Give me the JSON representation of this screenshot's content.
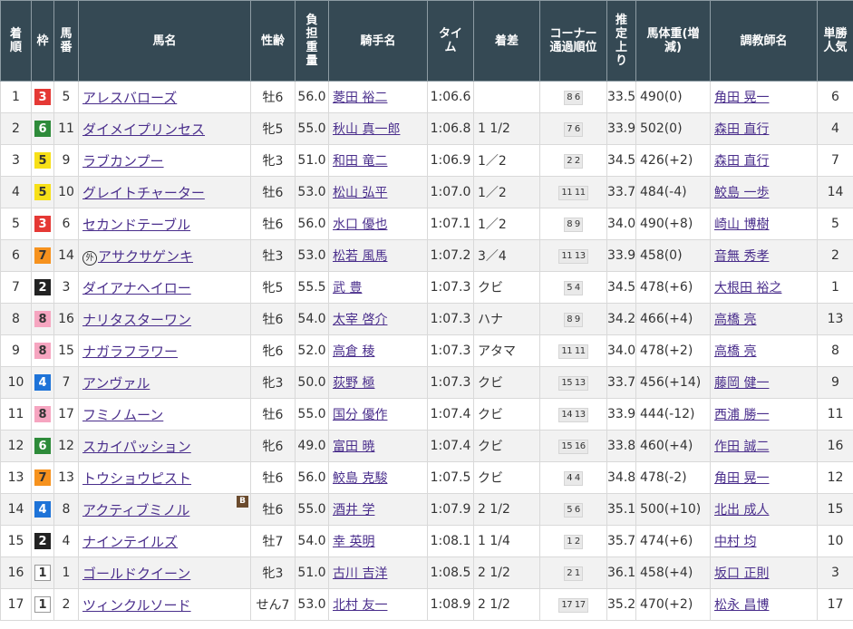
{
  "headers": {
    "rank": "着順",
    "waku": "枠",
    "num": "馬番",
    "name": "馬名",
    "sexage": "性齢",
    "weight": "負担重量",
    "jockey": "騎手名",
    "time": "タイム",
    "margin": "着差",
    "corner": "コーナー通過順位",
    "last3f": "推定上り",
    "body": "馬体重(増減)",
    "trainer": "調教師名",
    "pop": "単勝人気"
  },
  "waku_colors": {
    "1": {
      "bg": "#ffffff",
      "fg": "#333333",
      "border": "#999999"
    },
    "2": {
      "bg": "#222222",
      "fg": "#ffffff",
      "border": "#222222"
    },
    "3": {
      "bg": "#e53935",
      "fg": "#ffffff",
      "border": "#e53935"
    },
    "4": {
      "bg": "#1e73d8",
      "fg": "#ffffff",
      "border": "#1e73d8"
    },
    "5": {
      "bg": "#f7e018",
      "fg": "#333333",
      "border": "#f7e018"
    },
    "6": {
      "bg": "#2e8b3a",
      "fg": "#ffffff",
      "border": "#2e8b3a"
    },
    "7": {
      "bg": "#f6921e",
      "fg": "#333333",
      "border": "#f6921e"
    },
    "8": {
      "bg": "#f6a5c0",
      "fg": "#333333",
      "border": "#f6a5c0"
    }
  },
  "rows": [
    {
      "rank": "1",
      "waku": "3",
      "num": "5",
      "name": "アレスバローズ",
      "sexage": "牡6",
      "weight": "56.0",
      "jockey": "菱田 裕二",
      "time": "1:06.6",
      "margin": "",
      "corner": "8 6",
      "last3f": "33.5",
      "body": "490(0)",
      "trainer": "角田 晃一",
      "pop": "6"
    },
    {
      "rank": "2",
      "waku": "6",
      "num": "11",
      "name": "ダイメイプリンセス",
      "sexage": "牝5",
      "weight": "55.0",
      "jockey": "秋山 真一郎",
      "time": "1:06.8",
      "margin": "1 1/2",
      "corner": "7 6",
      "last3f": "33.9",
      "body": "502(0)",
      "trainer": "森田 直行",
      "pop": "4"
    },
    {
      "rank": "3",
      "waku": "5",
      "num": "9",
      "name": "ラブカンプー",
      "sexage": "牝3",
      "weight": "51.0",
      "jockey": "和田 竜二",
      "time": "1:06.9",
      "margin": "1／2",
      "corner": "2 2",
      "last3f": "34.5",
      "body": "426(+2)",
      "trainer": "森田 直行",
      "pop": "7"
    },
    {
      "rank": "4",
      "waku": "5",
      "num": "10",
      "name": "グレイトチャーター",
      "sexage": "牡6",
      "weight": "53.0",
      "jockey": "松山 弘平",
      "time": "1:07.0",
      "margin": "1／2",
      "corner": "11 11",
      "last3f": "33.7",
      "body": "484(-4)",
      "trainer": "鮫島 一歩",
      "pop": "14"
    },
    {
      "rank": "5",
      "waku": "3",
      "num": "6",
      "name": "セカンドテーブル",
      "sexage": "牡6",
      "weight": "56.0",
      "jockey": "水口 優也",
      "time": "1:07.1",
      "margin": "1／2",
      "corner": "8 9",
      "last3f": "34.0",
      "body": "490(+8)",
      "trainer": "崎山 博樹",
      "pop": "5"
    },
    {
      "rank": "6",
      "waku": "7",
      "num": "14",
      "name": "アサクサゲンキ",
      "maru": "外",
      "sexage": "牡3",
      "weight": "53.0",
      "jockey": "松若 風馬",
      "time": "1:07.2",
      "margin": "3／4",
      "corner": "11 13",
      "last3f": "33.9",
      "body": "458(0)",
      "trainer": "音無 秀孝",
      "pop": "2"
    },
    {
      "rank": "7",
      "waku": "2",
      "num": "3",
      "name": "ダイアナヘイロー",
      "sexage": "牝5",
      "weight": "55.5",
      "jockey": "武 豊",
      "time": "1:07.3",
      "margin": "クビ",
      "corner": "5 4",
      "last3f": "34.5",
      "body": "478(+6)",
      "trainer": "大根田 裕之",
      "pop": "1"
    },
    {
      "rank": "8",
      "waku": "8",
      "num": "16",
      "name": "ナリタスターワン",
      "sexage": "牡6",
      "weight": "54.0",
      "jockey": "太宰 啓介",
      "time": "1:07.3",
      "margin": "ハナ",
      "corner": "8 9",
      "last3f": "34.2",
      "body": "466(+4)",
      "trainer": "高橋 亮",
      "pop": "13"
    },
    {
      "rank": "9",
      "waku": "8",
      "num": "15",
      "name": "ナガラフラワー",
      "sexage": "牝6",
      "weight": "52.0",
      "jockey": "高倉 稜",
      "time": "1:07.3",
      "margin": "アタマ",
      "corner": "11 11",
      "last3f": "34.0",
      "body": "478(+2)",
      "trainer": "高橋 亮",
      "pop": "8"
    },
    {
      "rank": "10",
      "waku": "4",
      "num": "7",
      "name": "アンヴァル",
      "sexage": "牝3",
      "weight": "50.0",
      "jockey": "荻野 極",
      "time": "1:07.3",
      "margin": "クビ",
      "corner": "15 13",
      "last3f": "33.7",
      "body": "456(+14)",
      "trainer": "藤岡 健一",
      "pop": "9"
    },
    {
      "rank": "11",
      "waku": "8",
      "num": "17",
      "name": "フミノムーン",
      "sexage": "牡6",
      "weight": "55.0",
      "jockey": "国分 優作",
      "time": "1:07.4",
      "margin": "クビ",
      "corner": "14 13",
      "last3f": "33.9",
      "body": "444(-12)",
      "trainer": "西浦 勝一",
      "pop": "11"
    },
    {
      "rank": "12",
      "waku": "6",
      "num": "12",
      "name": "スカイパッション",
      "sexage": "牝6",
      "weight": "49.0",
      "jockey": "富田 暁",
      "time": "1:07.4",
      "margin": "クビ",
      "corner": "15 16",
      "last3f": "33.8",
      "body": "460(+4)",
      "trainer": "作田 誠二",
      "pop": "16"
    },
    {
      "rank": "13",
      "waku": "7",
      "num": "13",
      "name": "トウショウピスト",
      "sexage": "牡6",
      "weight": "56.0",
      "jockey": "鮫島 克駿",
      "time": "1:07.5",
      "margin": "クビ",
      "corner": "4 4",
      "last3f": "34.8",
      "body": "478(-2)",
      "trainer": "角田 晃一",
      "pop": "12"
    },
    {
      "rank": "14",
      "waku": "4",
      "num": "8",
      "name": "アクティブミノル",
      "blinker": "B",
      "sexage": "牡6",
      "weight": "55.0",
      "jockey": "酒井 学",
      "time": "1:07.9",
      "margin": "2 1/2",
      "corner": "5 6",
      "last3f": "35.1",
      "body": "500(+10)",
      "trainer": "北出 成人",
      "pop": "15"
    },
    {
      "rank": "15",
      "waku": "2",
      "num": "4",
      "name": "ナインテイルズ",
      "sexage": "牡7",
      "weight": "54.0",
      "jockey": "幸 英明",
      "time": "1:08.1",
      "margin": "1 1/4",
      "corner": "1 2",
      "last3f": "35.7",
      "body": "474(+6)",
      "trainer": "中村 均",
      "pop": "10"
    },
    {
      "rank": "16",
      "waku": "1",
      "num": "1",
      "name": "ゴールドクイーン",
      "sexage": "牝3",
      "weight": "51.0",
      "jockey": "古川 吉洋",
      "time": "1:08.5",
      "margin": "2 1/2",
      "corner": "2 1",
      "last3f": "36.1",
      "body": "458(+4)",
      "trainer": "坂口 正則",
      "pop": "3"
    },
    {
      "rank": "17",
      "waku": "1",
      "num": "2",
      "name": "ツィンクルソード",
      "sexage": "せん7",
      "weight": "53.0",
      "jockey": "北村 友一",
      "time": "1:08.9",
      "margin": "2 1/2",
      "corner": "17 17",
      "last3f": "35.2",
      "body": "470(+2)",
      "trainer": "松永 昌博",
      "pop": "17"
    }
  ]
}
